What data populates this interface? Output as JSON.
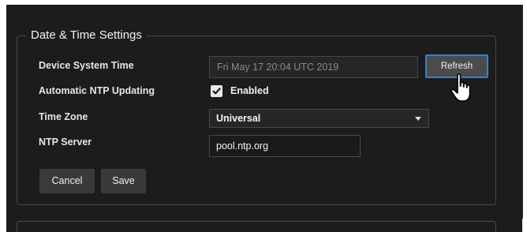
{
  "section": {
    "title": "Date & Time Settings"
  },
  "fields": {
    "device_system_time": {
      "label": "Device System Time",
      "value": "Fri May 17 20:04 UTC 2019",
      "refresh_label": "Refresh"
    },
    "ntp_updating": {
      "label": "Automatic NTP Updating",
      "checked": true,
      "checkbox_label": "Enabled"
    },
    "time_zone": {
      "label": "Time Zone",
      "selected": "Universal"
    },
    "ntp_server": {
      "label": "NTP Server",
      "value": "pool.ntp.org"
    }
  },
  "actions": {
    "cancel_label": "Cancel",
    "save_label": "Save"
  },
  "colors": {
    "panel_bg": "#1c1c1c",
    "focus_border": "#3d7fc1",
    "button_bg": "#3a3a3a"
  },
  "icons": {
    "cursor": "hand-pointer-icon",
    "checkbox": "checkmark-icon",
    "dropdown": "chevron-down-icon"
  }
}
